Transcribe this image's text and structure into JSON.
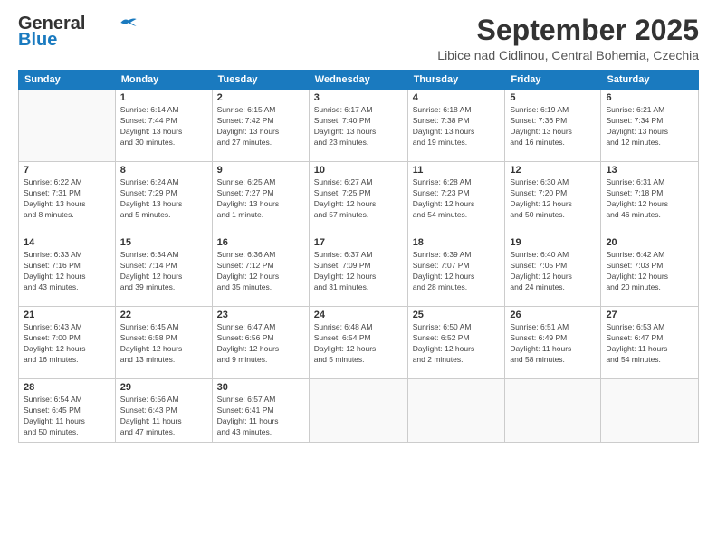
{
  "logo": {
    "line1": "General",
    "line2": "Blue"
  },
  "title": "September 2025",
  "location": "Libice nad Cidlinou, Central Bohemia, Czechia",
  "weekdays": [
    "Sunday",
    "Monday",
    "Tuesday",
    "Wednesday",
    "Thursday",
    "Friday",
    "Saturday"
  ],
  "weeks": [
    [
      {
        "day": "",
        "info": ""
      },
      {
        "day": "1",
        "info": "Sunrise: 6:14 AM\nSunset: 7:44 PM\nDaylight: 13 hours\nand 30 minutes."
      },
      {
        "day": "2",
        "info": "Sunrise: 6:15 AM\nSunset: 7:42 PM\nDaylight: 13 hours\nand 27 minutes."
      },
      {
        "day": "3",
        "info": "Sunrise: 6:17 AM\nSunset: 7:40 PM\nDaylight: 13 hours\nand 23 minutes."
      },
      {
        "day": "4",
        "info": "Sunrise: 6:18 AM\nSunset: 7:38 PM\nDaylight: 13 hours\nand 19 minutes."
      },
      {
        "day": "5",
        "info": "Sunrise: 6:19 AM\nSunset: 7:36 PM\nDaylight: 13 hours\nand 16 minutes."
      },
      {
        "day": "6",
        "info": "Sunrise: 6:21 AM\nSunset: 7:34 PM\nDaylight: 13 hours\nand 12 minutes."
      }
    ],
    [
      {
        "day": "7",
        "info": "Sunrise: 6:22 AM\nSunset: 7:31 PM\nDaylight: 13 hours\nand 8 minutes."
      },
      {
        "day": "8",
        "info": "Sunrise: 6:24 AM\nSunset: 7:29 PM\nDaylight: 13 hours\nand 5 minutes."
      },
      {
        "day": "9",
        "info": "Sunrise: 6:25 AM\nSunset: 7:27 PM\nDaylight: 13 hours\nand 1 minute."
      },
      {
        "day": "10",
        "info": "Sunrise: 6:27 AM\nSunset: 7:25 PM\nDaylight: 12 hours\nand 57 minutes."
      },
      {
        "day": "11",
        "info": "Sunrise: 6:28 AM\nSunset: 7:23 PM\nDaylight: 12 hours\nand 54 minutes."
      },
      {
        "day": "12",
        "info": "Sunrise: 6:30 AM\nSunset: 7:20 PM\nDaylight: 12 hours\nand 50 minutes."
      },
      {
        "day": "13",
        "info": "Sunrise: 6:31 AM\nSunset: 7:18 PM\nDaylight: 12 hours\nand 46 minutes."
      }
    ],
    [
      {
        "day": "14",
        "info": "Sunrise: 6:33 AM\nSunset: 7:16 PM\nDaylight: 12 hours\nand 43 minutes."
      },
      {
        "day": "15",
        "info": "Sunrise: 6:34 AM\nSunset: 7:14 PM\nDaylight: 12 hours\nand 39 minutes."
      },
      {
        "day": "16",
        "info": "Sunrise: 6:36 AM\nSunset: 7:12 PM\nDaylight: 12 hours\nand 35 minutes."
      },
      {
        "day": "17",
        "info": "Sunrise: 6:37 AM\nSunset: 7:09 PM\nDaylight: 12 hours\nand 31 minutes."
      },
      {
        "day": "18",
        "info": "Sunrise: 6:39 AM\nSunset: 7:07 PM\nDaylight: 12 hours\nand 28 minutes."
      },
      {
        "day": "19",
        "info": "Sunrise: 6:40 AM\nSunset: 7:05 PM\nDaylight: 12 hours\nand 24 minutes."
      },
      {
        "day": "20",
        "info": "Sunrise: 6:42 AM\nSunset: 7:03 PM\nDaylight: 12 hours\nand 20 minutes."
      }
    ],
    [
      {
        "day": "21",
        "info": "Sunrise: 6:43 AM\nSunset: 7:00 PM\nDaylight: 12 hours\nand 16 minutes."
      },
      {
        "day": "22",
        "info": "Sunrise: 6:45 AM\nSunset: 6:58 PM\nDaylight: 12 hours\nand 13 minutes."
      },
      {
        "day": "23",
        "info": "Sunrise: 6:47 AM\nSunset: 6:56 PM\nDaylight: 12 hours\nand 9 minutes."
      },
      {
        "day": "24",
        "info": "Sunrise: 6:48 AM\nSunset: 6:54 PM\nDaylight: 12 hours\nand 5 minutes."
      },
      {
        "day": "25",
        "info": "Sunrise: 6:50 AM\nSunset: 6:52 PM\nDaylight: 12 hours\nand 2 minutes."
      },
      {
        "day": "26",
        "info": "Sunrise: 6:51 AM\nSunset: 6:49 PM\nDaylight: 11 hours\nand 58 minutes."
      },
      {
        "day": "27",
        "info": "Sunrise: 6:53 AM\nSunset: 6:47 PM\nDaylight: 11 hours\nand 54 minutes."
      }
    ],
    [
      {
        "day": "28",
        "info": "Sunrise: 6:54 AM\nSunset: 6:45 PM\nDaylight: 11 hours\nand 50 minutes."
      },
      {
        "day": "29",
        "info": "Sunrise: 6:56 AM\nSunset: 6:43 PM\nDaylight: 11 hours\nand 47 minutes."
      },
      {
        "day": "30",
        "info": "Sunrise: 6:57 AM\nSunset: 6:41 PM\nDaylight: 11 hours\nand 43 minutes."
      },
      {
        "day": "",
        "info": ""
      },
      {
        "day": "",
        "info": ""
      },
      {
        "day": "",
        "info": ""
      },
      {
        "day": "",
        "info": ""
      }
    ]
  ]
}
